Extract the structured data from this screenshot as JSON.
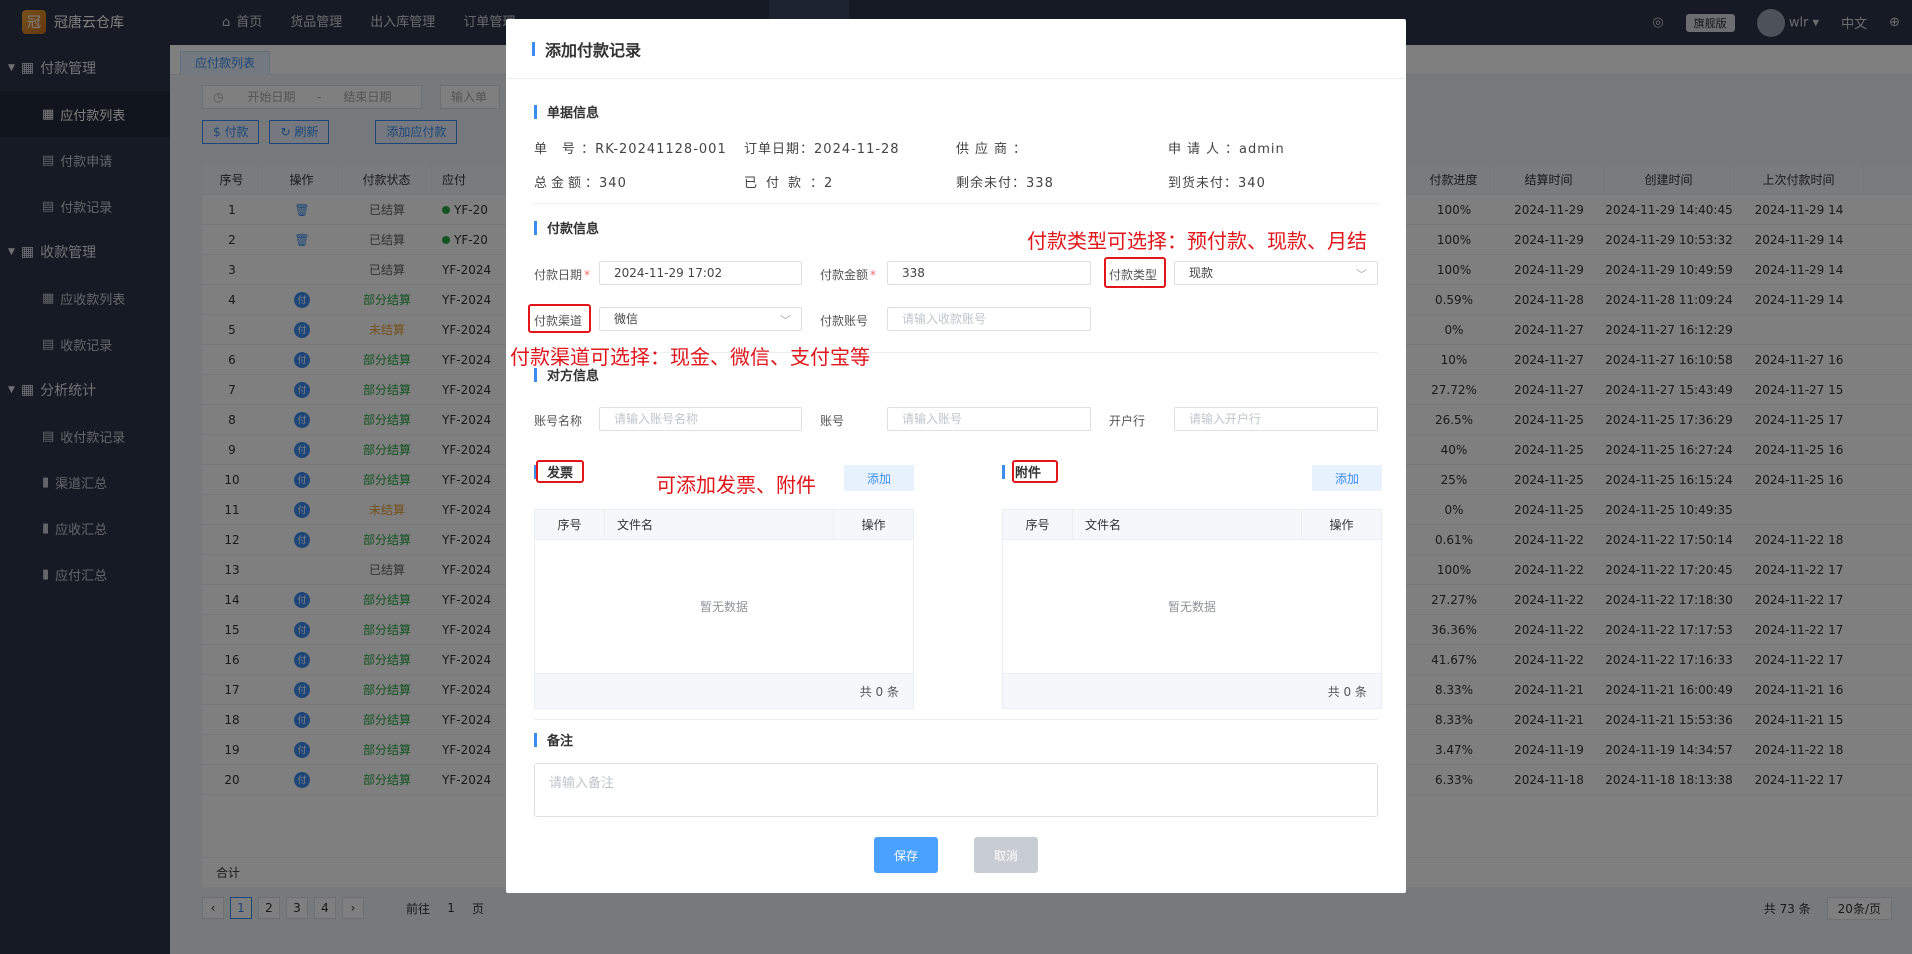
{
  "app": {
    "title": "冠唐云仓库",
    "logo_glyph": "冠"
  },
  "topnav": [
    {
      "label": "首页",
      "active": false
    },
    {
      "label": "货品管理",
      "active": false
    },
    {
      "label": "出入库管理",
      "active": false
    },
    {
      "label": "订单管理",
      "active": false
    },
    {
      "label": "",
      "active": false
    },
    {
      "label": "",
      "active": false
    },
    {
      "label": "",
      "active": false
    },
    {
      "label": "",
      "active": true
    },
    {
      "label": "",
      "active": false
    }
  ],
  "top_right": {
    "edition": "旗舰版",
    "user": "wlr",
    "lang": "中文"
  },
  "sidebar": [
    {
      "type": "group",
      "label": "付款管理"
    },
    {
      "type": "item",
      "label": "应付款列表",
      "active": true,
      "icon": "grid"
    },
    {
      "type": "item",
      "label": "付款申请",
      "active": false,
      "icon": "doc"
    },
    {
      "type": "item",
      "label": "付款记录",
      "active": false,
      "icon": "doc"
    },
    {
      "type": "group",
      "label": "收款管理"
    },
    {
      "type": "item",
      "label": "应收款列表",
      "active": false,
      "icon": "grid"
    },
    {
      "type": "item",
      "label": "收款记录",
      "active": false,
      "icon": "doc"
    },
    {
      "type": "group",
      "label": "分析统计"
    },
    {
      "type": "item",
      "label": "收付款记录",
      "active": false,
      "icon": "doc"
    },
    {
      "type": "item",
      "label": "渠道汇总",
      "active": false,
      "icon": "bar"
    },
    {
      "type": "item",
      "label": "应收汇总",
      "active": false,
      "icon": "bar"
    },
    {
      "type": "item",
      "label": "应付汇总",
      "active": false,
      "icon": "bar"
    }
  ],
  "tab": {
    "label": "应付款列表"
  },
  "filters": {
    "start": "开始日期",
    "sep": "-",
    "end": "结束日期",
    "input": "输入单"
  },
  "buttons": {
    "pay": "付款",
    "refresh": "刷新",
    "add": "添加应付款"
  },
  "table": {
    "headers": [
      "序号",
      "操作",
      "付款状态",
      "应付"
    ],
    "right_headers": [
      "付款进度",
      "结算时间",
      "创建时间",
      "上次付款时间"
    ],
    "rows": [
      {
        "no": "1",
        "op": "del",
        "status": "已结算",
        "st": "done",
        "code": "YF-20",
        "dot": true,
        "progress": "100%",
        "settle": "2024-11-29",
        "created": "2024-11-29 14:40:45",
        "last": "2024-11-29 14"
      },
      {
        "no": "2",
        "op": "del",
        "status": "已结算",
        "st": "done",
        "code": "YF-20",
        "dot": true,
        "progress": "100%",
        "settle": "2024-11-29",
        "created": "2024-11-29 10:53:32",
        "last": "2024-11-29 14"
      },
      {
        "no": "3",
        "op": "",
        "status": "已结算",
        "st": "done",
        "code": "YF-2024",
        "dot": false,
        "progress": "100%",
        "settle": "2024-11-29",
        "created": "2024-11-29 10:49:59",
        "last": "2024-11-29 14"
      },
      {
        "no": "4",
        "op": "pay",
        "status": "部分结算",
        "st": "part",
        "code": "YF-2024",
        "dot": false,
        "progress": "0.59%",
        "settle": "2024-11-28",
        "created": "2024-11-28 11:09:24",
        "last": "2024-11-29 14"
      },
      {
        "no": "5",
        "op": "pay",
        "status": "未结算",
        "st": "un",
        "code": "YF-2024",
        "dot": false,
        "progress": "0%",
        "settle": "2024-11-27",
        "created": "2024-11-27 16:12:29",
        "last": ""
      },
      {
        "no": "6",
        "op": "pay",
        "status": "部分结算",
        "st": "part",
        "code": "YF-2024",
        "dot": false,
        "progress": "10%",
        "settle": "2024-11-27",
        "created": "2024-11-27 16:10:58",
        "last": "2024-11-27 16"
      },
      {
        "no": "7",
        "op": "pay",
        "status": "部分结算",
        "st": "part",
        "code": "YF-2024",
        "dot": false,
        "progress": "27.72%",
        "settle": "2024-11-27",
        "created": "2024-11-27 15:43:49",
        "last": "2024-11-27 15"
      },
      {
        "no": "8",
        "op": "pay",
        "status": "部分结算",
        "st": "part",
        "code": "YF-2024",
        "dot": false,
        "progress": "26.5%",
        "settle": "2024-11-25",
        "created": "2024-11-25 17:36:29",
        "last": "2024-11-25 17"
      },
      {
        "no": "9",
        "op": "pay",
        "status": "部分结算",
        "st": "part",
        "code": "YF-2024",
        "dot": false,
        "progress": "40%",
        "settle": "2024-11-25",
        "created": "2024-11-25 16:27:24",
        "last": "2024-11-25 16"
      },
      {
        "no": "10",
        "op": "pay",
        "status": "部分结算",
        "st": "part",
        "code": "YF-2024",
        "dot": false,
        "progress": "25%",
        "settle": "2024-11-25",
        "created": "2024-11-25 16:15:24",
        "last": "2024-11-25 16"
      },
      {
        "no": "11",
        "op": "pay",
        "status": "未结算",
        "st": "un",
        "code": "YF-2024",
        "dot": false,
        "progress": "0%",
        "settle": "2024-11-25",
        "created": "2024-11-25 10:49:35",
        "last": ""
      },
      {
        "no": "12",
        "op": "pay",
        "status": "部分结算",
        "st": "part",
        "code": "YF-2024",
        "dot": false,
        "progress": "0.61%",
        "settle": "2024-11-22",
        "created": "2024-11-22 17:50:14",
        "last": "2024-11-22 18"
      },
      {
        "no": "13",
        "op": "",
        "status": "已结算",
        "st": "done",
        "code": "YF-2024",
        "dot": false,
        "progress": "100%",
        "settle": "2024-11-22",
        "created": "2024-11-22 17:20:45",
        "last": "2024-11-22 17"
      },
      {
        "no": "14",
        "op": "pay",
        "status": "部分结算",
        "st": "part",
        "code": "YF-2024",
        "dot": false,
        "progress": "27.27%",
        "settle": "2024-11-22",
        "created": "2024-11-22 17:18:30",
        "last": "2024-11-22 17"
      },
      {
        "no": "15",
        "op": "pay",
        "status": "部分结算",
        "st": "part",
        "code": "YF-2024",
        "dot": false,
        "progress": "36.36%",
        "settle": "2024-11-22",
        "created": "2024-11-22 17:17:53",
        "last": "2024-11-22 17"
      },
      {
        "no": "16",
        "op": "pay",
        "status": "部分结算",
        "st": "part",
        "code": "YF-2024",
        "dot": false,
        "progress": "41.67%",
        "settle": "2024-11-22",
        "created": "2024-11-22 17:16:33",
        "last": "2024-11-22 17"
      },
      {
        "no": "17",
        "op": "pay",
        "status": "部分结算",
        "st": "part",
        "code": "YF-2024",
        "dot": false,
        "progress": "8.33%",
        "settle": "2024-11-21",
        "created": "2024-11-21 16:00:49",
        "last": "2024-11-21 16"
      },
      {
        "no": "18",
        "op": "pay",
        "status": "部分结算",
        "st": "part",
        "code": "YF-2024",
        "dot": false,
        "progress": "8.33%",
        "settle": "2024-11-21",
        "created": "2024-11-21 15:53:36",
        "last": "2024-11-21 15"
      },
      {
        "no": "19",
        "op": "pay",
        "status": "部分结算",
        "st": "part",
        "code": "YF-2024",
        "dot": false,
        "progress": "3.47%",
        "settle": "2024-11-19",
        "created": "2024-11-19 14:34:57",
        "last": "2024-11-22 18"
      },
      {
        "no": "20",
        "op": "pay",
        "status": "部分结算",
        "st": "part",
        "code": "YF-2024",
        "dot": false,
        "progress": "6.33%",
        "settle": "2024-11-18",
        "created": "2024-11-18 18:13:38",
        "last": "2024-11-22 17"
      }
    ],
    "footer": "合计"
  },
  "pager": {
    "pages": [
      "1",
      "2",
      "3",
      "4"
    ],
    "current": "1",
    "goto_label": "前往",
    "goto_value": "1",
    "page_label": "页",
    "total": "共 73 条",
    "size": "20条/页"
  },
  "modal": {
    "title": "添加付款记录",
    "sections": {
      "doc": "单据信息",
      "pay": "付款信息",
      "party": "对方信息",
      "invoice": "发票",
      "attach": "附件",
      "remark": "备注"
    },
    "doc": {
      "no_label": "单　号",
      "no": "RK-20241128-001",
      "date_label": "订单日期",
      "date": "2024-11-28",
      "supplier_label": "供应商",
      "supplier": "",
      "applicant_label": "申请人",
      "applicant": "admin",
      "total_label": "总金额",
      "total": "340",
      "paid_label": "已付款",
      "paid": "2",
      "remain_label": "剩余未付",
      "remain": "338",
      "arrival_label": "到货未付",
      "arrival": "340"
    },
    "pay": {
      "date_label": "付款日期",
      "date": "2024-11-29 17:02",
      "amount_label": "付款金额",
      "amount": "338",
      "type_label": "付款类型",
      "type": "现款",
      "channel_label": "付款渠道",
      "channel": "微信",
      "account_label": "付款账号",
      "account_ph": "请输入收款账号"
    },
    "party": {
      "name_label": "账号名称",
      "name_ph": "请输入账号名称",
      "acct_label": "账号",
      "acct_ph": "请输入账号",
      "bank_label": "开户行",
      "bank_ph": "请输入开户行"
    },
    "add_label": "添加",
    "subtable": {
      "no": "序号",
      "file": "文件名",
      "op": "操作",
      "empty": "暂无数据",
      "total": "共 0 条"
    },
    "remark_ph": "请输入备注",
    "save": "保存",
    "cancel": "取消"
  },
  "annotations": {
    "type_note": "付款类型可选择：预付款、现款、月结",
    "channel_note": "付款渠道可选择：现金、微信、支付宝等",
    "attach_note": "可添加发票、附件"
  },
  "colors": {
    "accent": "#3c8cf0",
    "sidebar": "#2b3548",
    "annotation": "#e0161a",
    "success": "#27a745",
    "warning": "#e8a23a"
  }
}
